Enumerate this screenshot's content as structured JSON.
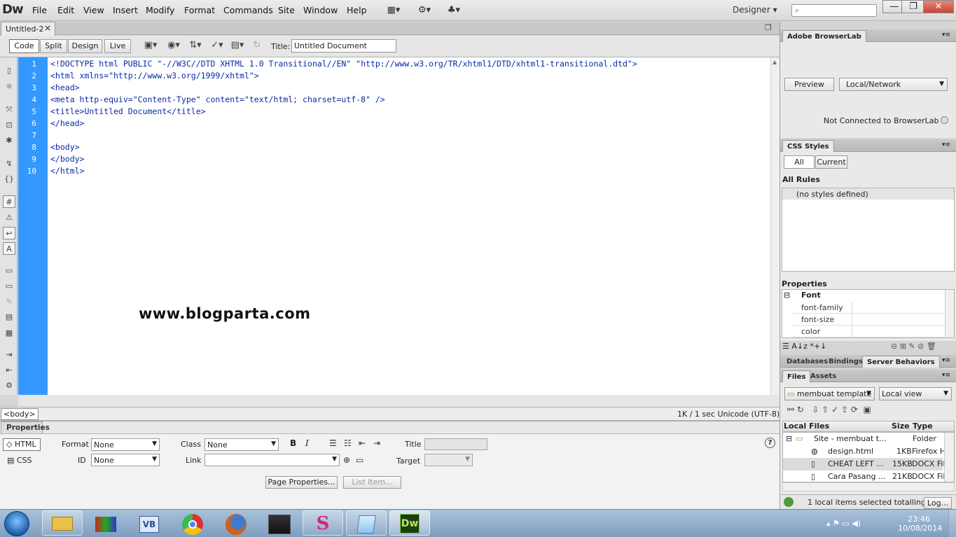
{
  "app": {
    "logo": "Dw"
  },
  "menu": [
    "File",
    "Edit",
    "View",
    "Insert",
    "Modify",
    "Format",
    "Commands",
    "Site",
    "Window",
    "Help"
  ],
  "workspace": {
    "label": "Designer",
    "arrow": "▾"
  },
  "window_controls": {
    "minimize": "—",
    "restore": "❐",
    "close": "✕"
  },
  "document": {
    "tab_label": "Untitled-2",
    "tab_close": "×",
    "views": [
      "Code",
      "Split",
      "Design",
      "Live"
    ],
    "title_label": "Title:",
    "title_value": "Untitled Document"
  },
  "code": {
    "line_numbers": [
      "1",
      "2",
      "3",
      "4",
      "5",
      "6",
      "7",
      "8",
      "9",
      "10"
    ],
    "lines": [
      "<!DOCTYPE html PUBLIC \"-//W3C//DTD XHTML 1.0 Transitional//EN\" \"http://www.w3.org/TR/xhtml1/DTD/xhtml1-transitional.dtd\">",
      "<html xmlns=\"http://www.w3.org/1999/xhtml\">",
      "<head>",
      "<meta http-equiv=\"Content-Type\" content=\"text/html; charset=utf-8\" />",
      "<title>Untitled Document</title>",
      "</head>",
      "",
      "<body>",
      "</body>",
      "</html>"
    ],
    "watermark": "www.blogparta.com"
  },
  "status": {
    "tag": "<body>",
    "right": "1K / 1 sec  Unicode (UTF-8)"
  },
  "properties": {
    "tab": "Properties",
    "html_btn": "HTML",
    "css_btn": "CSS",
    "format_label": "Format",
    "format_value": "None",
    "id_label": "ID",
    "id_value": "None",
    "class_label": "Class",
    "class_value": "None",
    "link_label": "Link",
    "title_label": "Title",
    "target_label": "Target",
    "bold": "B",
    "italic": "I",
    "page_properties": "Page Properties...",
    "list_item": "List Item...",
    "help": "?"
  },
  "browserlab": {
    "tab": "Adobe BrowserLab",
    "preview": "Preview",
    "mode": "Local/Network",
    "status": "Not Connected to BrowserLab"
  },
  "css_styles": {
    "tab": "CSS Styles",
    "all": "All",
    "current": "Current",
    "rules_label": "All Rules",
    "rules_value": "(no styles defined)",
    "properties_label": "Properties",
    "font_label": "Font",
    "props": [
      "font-family",
      "font-size",
      "color"
    ]
  },
  "db_tabs": [
    "Databases",
    "Bindings",
    "Server Behaviors"
  ],
  "files": {
    "tabs": [
      "Files",
      "Assets"
    ],
    "site": "membuat template",
    "view": "Local view",
    "headers": {
      "name": "Local Files",
      "size": "Size",
      "type": "Type"
    },
    "rows": [
      {
        "name": "Site - membuat t...",
        "size": "",
        "type": "Folder"
      },
      {
        "name": "design.html",
        "size": "1KB",
        "type": "Firefox H"
      },
      {
        "name": "CHEAT LEFT ...",
        "size": "15KB",
        "type": "DOCX File"
      },
      {
        "name": "Cara Pasang ...",
        "size": "21KB",
        "type": "DOCX File"
      }
    ],
    "status": "1 local items selected totalling",
    "log_button": "Log..."
  },
  "taskbar": {
    "time": "23:46",
    "date": "10/08/2014"
  },
  "colors": {
    "gutter": "#3399ff",
    "code_text": "#0a2aa8"
  }
}
